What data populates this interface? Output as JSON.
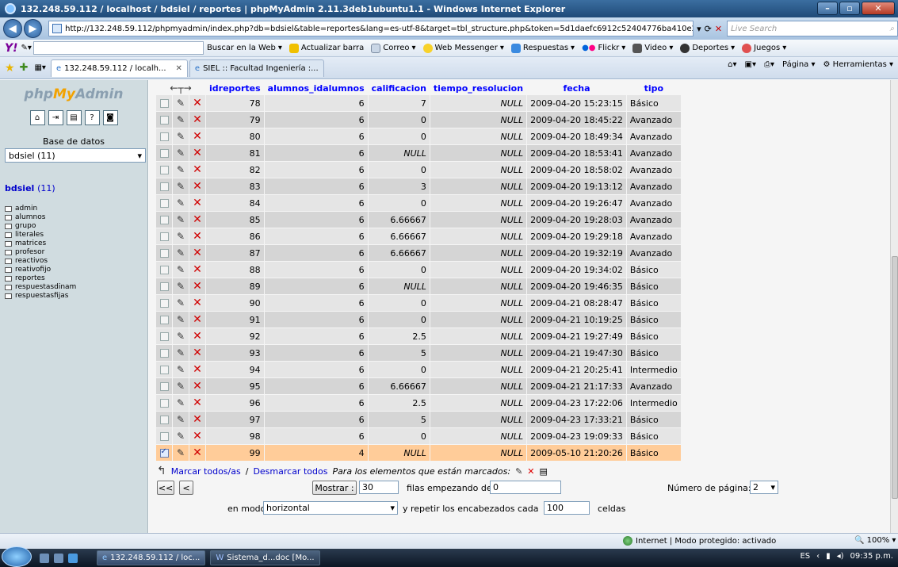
{
  "window": {
    "title": "132.248.59.112 / localhost / bdsiel / reportes | phpMyAdmin 2.11.3deb1ubuntu1.1 - Windows Internet Explorer"
  },
  "address": {
    "url": "http://132.248.59.112/phpmyadmin/index.php?db=bdsiel&table=reportes&lang=es-utf-8&target=tbl_structure.php&token=5d1daefc6912c52404776ba410e2fe91",
    "live_search": "Live Search"
  },
  "yahoo_toolbar": {
    "search_btn": "Buscar en la Web",
    "items": [
      "Actualizar barra",
      "Correo",
      "Web Messenger",
      "Respuestas",
      "Flickr",
      "Video",
      "Deportes",
      "Juegos"
    ]
  },
  "tabs": [
    {
      "label": "132.248.59.112 / localh..."
    },
    {
      "label": "SIEL :: Facultad Ingeniería :..."
    }
  ],
  "tab_tools": {
    "page": "Página",
    "tools": "Herramientas"
  },
  "sidebar": {
    "logo_php": "php",
    "logo_my": "My",
    "logo_admin": "Admin",
    "db_label": "Base de datos",
    "db_selected": "bdsiel (11)",
    "db_link_name": "bdsiel",
    "db_link_count": "(11)",
    "tables": [
      "admin",
      "alumnos",
      "grupo",
      "literales",
      "matrices",
      "profesor",
      "reactivos",
      "reativofijo",
      "reportes",
      "respuestasdinam",
      "respuestasfijas"
    ]
  },
  "grid": {
    "columns": [
      "idreportes",
      "alumnos_idalumnos",
      "calificacion",
      "tiempo_resolucion",
      "fecha",
      "tipo"
    ],
    "rows": [
      {
        "id": "78",
        "alumno": "6",
        "calif": "7",
        "tiempo": "NULL",
        "fecha": "2009-04-20 15:23:15",
        "tipo": "Básico"
      },
      {
        "id": "79",
        "alumno": "6",
        "calif": "0",
        "tiempo": "NULL",
        "fecha": "2009-04-20 18:45:22",
        "tipo": "Avanzado"
      },
      {
        "id": "80",
        "alumno": "6",
        "calif": "0",
        "tiempo": "NULL",
        "fecha": "2009-04-20 18:49:34",
        "tipo": "Avanzado"
      },
      {
        "id": "81",
        "alumno": "6",
        "calif": "NULL",
        "tiempo": "NULL",
        "fecha": "2009-04-20 18:53:41",
        "tipo": "Avanzado"
      },
      {
        "id": "82",
        "alumno": "6",
        "calif": "0",
        "tiempo": "NULL",
        "fecha": "2009-04-20 18:58:02",
        "tipo": "Avanzado"
      },
      {
        "id": "83",
        "alumno": "6",
        "calif": "3",
        "tiempo": "NULL",
        "fecha": "2009-04-20 19:13:12",
        "tipo": "Avanzado"
      },
      {
        "id": "84",
        "alumno": "6",
        "calif": "0",
        "tiempo": "NULL",
        "fecha": "2009-04-20 19:26:47",
        "tipo": "Avanzado"
      },
      {
        "id": "85",
        "alumno": "6",
        "calif": "6.66667",
        "tiempo": "NULL",
        "fecha": "2009-04-20 19:28:03",
        "tipo": "Avanzado"
      },
      {
        "id": "86",
        "alumno": "6",
        "calif": "6.66667",
        "tiempo": "NULL",
        "fecha": "2009-04-20 19:29:18",
        "tipo": "Avanzado"
      },
      {
        "id": "87",
        "alumno": "6",
        "calif": "6.66667",
        "tiempo": "NULL",
        "fecha": "2009-04-20 19:32:19",
        "tipo": "Avanzado"
      },
      {
        "id": "88",
        "alumno": "6",
        "calif": "0",
        "tiempo": "NULL",
        "fecha": "2009-04-20 19:34:02",
        "tipo": "Básico"
      },
      {
        "id": "89",
        "alumno": "6",
        "calif": "NULL",
        "tiempo": "NULL",
        "fecha": "2009-04-20 19:46:35",
        "tipo": "Básico"
      },
      {
        "id": "90",
        "alumno": "6",
        "calif": "0",
        "tiempo": "NULL",
        "fecha": "2009-04-21 08:28:47",
        "tipo": "Básico"
      },
      {
        "id": "91",
        "alumno": "6",
        "calif": "0",
        "tiempo": "NULL",
        "fecha": "2009-04-21 10:19:25",
        "tipo": "Básico"
      },
      {
        "id": "92",
        "alumno": "6",
        "calif": "2.5",
        "tiempo": "NULL",
        "fecha": "2009-04-21 19:27:49",
        "tipo": "Básico"
      },
      {
        "id": "93",
        "alumno": "6",
        "calif": "5",
        "tiempo": "NULL",
        "fecha": "2009-04-21 19:47:30",
        "tipo": "Básico"
      },
      {
        "id": "94",
        "alumno": "6",
        "calif": "0",
        "tiempo": "NULL",
        "fecha": "2009-04-21 20:25:41",
        "tipo": "Intermedio"
      },
      {
        "id": "95",
        "alumno": "6",
        "calif": "6.66667",
        "tiempo": "NULL",
        "fecha": "2009-04-21 21:17:33",
        "tipo": "Avanzado"
      },
      {
        "id": "96",
        "alumno": "6",
        "calif": "2.5",
        "tiempo": "NULL",
        "fecha": "2009-04-23 17:22:06",
        "tipo": "Intermedio"
      },
      {
        "id": "97",
        "alumno": "6",
        "calif": "5",
        "tiempo": "NULL",
        "fecha": "2009-04-23 17:33:21",
        "tipo": "Básico"
      },
      {
        "id": "98",
        "alumno": "6",
        "calif": "0",
        "tiempo": "NULL",
        "fecha": "2009-04-23 19:09:33",
        "tipo": "Básico"
      },
      {
        "id": "99",
        "alumno": "4",
        "calif": "NULL",
        "tiempo": "NULL",
        "fecha": "2009-05-10 21:20:26",
        "tipo": "Básico",
        "marked": true
      }
    ]
  },
  "bulk": {
    "mark_all": "Marcar todos/as",
    "separator": " / ",
    "unmark_all": "Desmarcar todos",
    "with_selected": "Para los elementos que están marcados:"
  },
  "pager": {
    "first": "<<",
    "prev": "<",
    "show_button": "Mostrar :",
    "rows_value": "30",
    "rows_label": "filas empezando de",
    "start_value": "0",
    "page_label": "Número de página:",
    "page_value": "2",
    "mode_label": "en modo",
    "mode_value": "horizontal",
    "repeat_label": "y repetir los encabezados cada",
    "repeat_value": "100",
    "cells_label": "celdas"
  },
  "status": {
    "zone": "Internet | Modo protegido: activado",
    "zoom": "100%"
  },
  "taskbar": {
    "tasks": [
      "132.248.59.112 / loc...",
      "Sistema_d...doc [Mo..."
    ],
    "lang": "ES",
    "clock": "09:35 p.m."
  }
}
